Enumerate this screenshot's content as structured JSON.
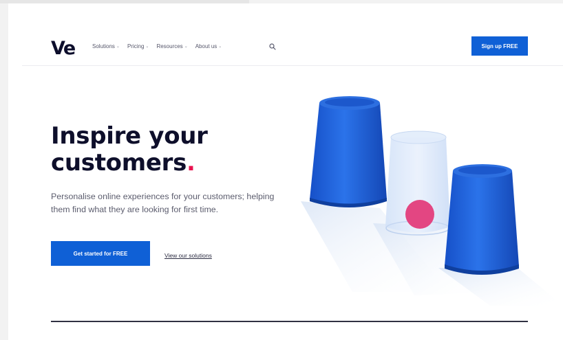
{
  "nav": {
    "logo": "Ve",
    "menu": [
      {
        "label": "Solutions"
      },
      {
        "label": "Pricing"
      },
      {
        "label": "Resources"
      },
      {
        "label": "About us"
      }
    ],
    "signup_label": "Sign up FREE"
  },
  "hero": {
    "headline_line1": "Inspire your",
    "headline_line2": "customers",
    "headline_dot": ".",
    "subtext": "Personalise online experiences for your customers; helping them find what they are looking for first time.",
    "cta_primary": "Get started for FREE",
    "cta_secondary": "View our solutions"
  },
  "colors": {
    "brand_blue": "#0f60d6",
    "accent_pink": "#e8134f",
    "cup_blue": "#1a5fd8",
    "ball": "#e8134f"
  },
  "icons": {
    "search": "search-icon",
    "chevron": "chevron-down-icon"
  }
}
